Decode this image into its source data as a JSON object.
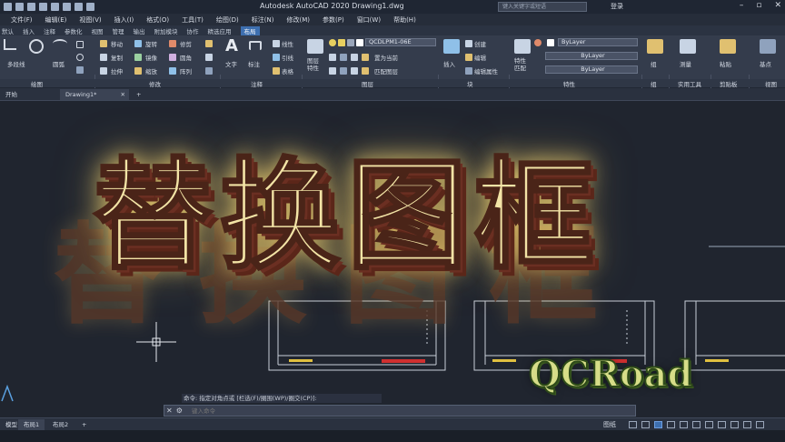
{
  "titlebar": {
    "app_title": "Autodesk AutoCAD 2020   Drawing1.dwg",
    "search_placeholder": "键入关键字或短语",
    "login_label": "登录"
  },
  "menu": {
    "items": [
      "文件(F)",
      "编辑(E)",
      "视图(V)",
      "插入(I)",
      "格式(O)",
      "工具(T)",
      "绘图(D)",
      "标注(N)",
      "修改(M)",
      "参数(P)",
      "窗口(W)",
      "帮助(H)"
    ]
  },
  "ribbon_tabs": {
    "items": [
      "默认",
      "插入",
      "注释",
      "参数化",
      "视图",
      "管理",
      "输出",
      "附加模块",
      "协作",
      "精选应用",
      "布局"
    ],
    "active": "布局"
  },
  "ribbon": {
    "draw": {
      "line": "多段线",
      "arc": "圆弧",
      "panel_title": "绘图"
    },
    "modify": {
      "move": "移动",
      "rotate": "旋转",
      "trim": "修剪",
      "copy": "复制",
      "mirror": "镜像",
      "fillet": "圆角",
      "stretch": "拉伸",
      "scale": "缩放",
      "array": "阵列",
      "panel_title": "修改"
    },
    "annotation": {
      "text": "文字",
      "dimension": "标注",
      "linear": "线性",
      "leader": "引线",
      "table": "表格",
      "panel_title": "注释"
    },
    "layers": {
      "layer_props": "图层\n特性",
      "current_layer": "QCDLPM1-06E",
      "make_current": "置为当前",
      "match": "匹配图层",
      "panel_title": "图层"
    },
    "block": {
      "insert": "插入",
      "create": "创建",
      "edit": "编辑",
      "edit_attr": "编辑属性",
      "panel_title": "块"
    },
    "properties": {
      "match": "特性\n匹配",
      "color": "ByLayer",
      "linetype": "ByLayer",
      "lineweight": "ByLayer",
      "panel_title": "特性"
    },
    "groups": {
      "label": "组",
      "panel_title": "组"
    },
    "utilities": {
      "measure": "测量",
      "panel_title": "实用工具"
    },
    "clipboard": {
      "paste": "粘贴",
      "panel_title": "剪贴板"
    },
    "view": {
      "base": "基点",
      "panel_title": "视图"
    }
  },
  "file_tabs": {
    "start": "开始",
    "drawing": "Drawing1*",
    "new_tab": "+"
  },
  "overlay": {
    "title": "替换图框",
    "brand": "QCRoad"
  },
  "command": {
    "history": "命令: 指定对角点或 [栏选(F)/圈围(WP)/圈交(CP)]:",
    "placeholder": "键入命令"
  },
  "layout_tabs": {
    "model": "模型",
    "layout1": "布局1",
    "layout2": "布局2",
    "add": "+"
  },
  "status": {
    "paper_label": "图纸"
  }
}
